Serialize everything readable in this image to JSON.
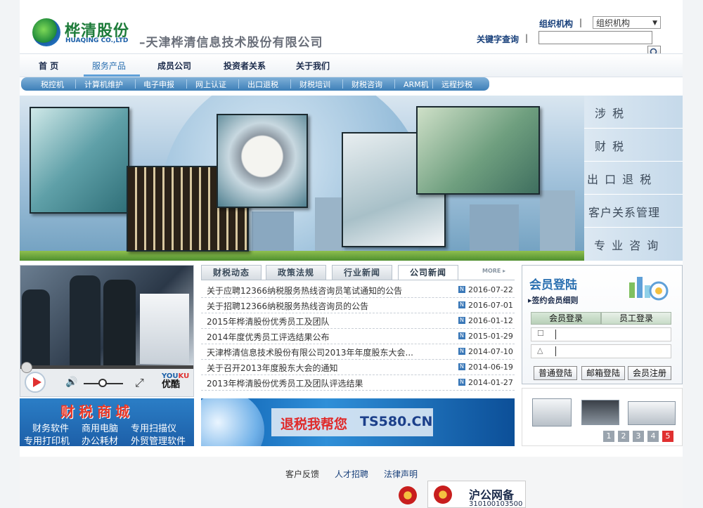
{
  "header": {
    "brand_cn": "桦清股份",
    "brand_en": "HUAQING CO.,LTD",
    "company_name": "–天津桦清信息技术股份有限公司",
    "org_label": "组织机构",
    "org_select_value": "组织机构",
    "keyword_label": "关键字查询",
    "keyword_value": "",
    "pipe": "|"
  },
  "nav": {
    "items": [
      "首 页",
      "服务产品",
      "成员公司",
      "投资者关系",
      "关于我们"
    ],
    "active": "服务产品"
  },
  "subnav": [
    "税控机",
    "计算机维护",
    "电子申报",
    "网上认证",
    "出口退税",
    "财税培训",
    "财税咨询",
    "ARM机",
    "远程抄税"
  ],
  "side_menu": [
    "涉  税",
    "财  税",
    "出 口 退 税",
    "客户关系管理",
    "专 业 咨 询"
  ],
  "video": {
    "brand_en_a": "YOU",
    "brand_en_b": "KU",
    "brand_cn": "优酷",
    "volume_icon": "🔊",
    "fullscreen_icon": "⤢"
  },
  "news": {
    "tabs": [
      "财税动态",
      "政策法规",
      "行业新闻",
      "公司新闻"
    ],
    "active_tab": "公司新闻",
    "more": "MORE ▸",
    "badge": "N",
    "items": [
      {
        "title": "关于应聘12366纳税服务热线咨询员笔试通知的公告",
        "date": "2016-07-22"
      },
      {
        "title": "关于招聘12366纳税服务热线咨询员的公告",
        "date": "2016-07-01"
      },
      {
        "title": "2015年桦清股份优秀员工及团队",
        "date": "2016-01-12"
      },
      {
        "title": "2014年度优秀员工评选结果公布",
        "date": "2015-01-29"
      },
      {
        "title": "天津桦清信息技术股份有限公司2013年年度股东大会...",
        "date": "2014-07-10"
      },
      {
        "title": "关于召开2013年度股东大会的通知",
        "date": "2014-06-19"
      },
      {
        "title": "2013年桦清股份优秀员工及团队评选结果",
        "date": "2014-01-27"
      }
    ]
  },
  "member": {
    "title": "会员登陆",
    "rules": "▸签约会员细则",
    "tab_member": "会员登录",
    "tab_staff": "员工登录",
    "username_value": "",
    "password_value": "",
    "btn_normal": "普通登陆",
    "btn_mail": "邮箱登陆",
    "btn_register": "会员注册"
  },
  "promo_mall": {
    "title": "财税商城",
    "lines": [
      "财务软件",
      "商用电脑",
      "专用扫描仪",
      "专用打印机",
      "办公耗材",
      "外贸管理软件"
    ]
  },
  "promo_ts": {
    "text1": "退税我帮您",
    "text2": "TS580.CN"
  },
  "printer_pages": [
    "1",
    "2",
    "3",
    "4",
    "5"
  ],
  "printer_active_page": "5",
  "footer": {
    "links": [
      "客户反馈",
      "人才招聘",
      "法律声明"
    ],
    "police_title": "沪公网备",
    "police_number": "310100103500"
  },
  "colors": {
    "nav_active": "#2a6fb0",
    "label_blue": "#173f7a",
    "subnav_blue": "#3d7fb8",
    "badge_blue": "#3a78b8",
    "page_active": "#e03030"
  }
}
